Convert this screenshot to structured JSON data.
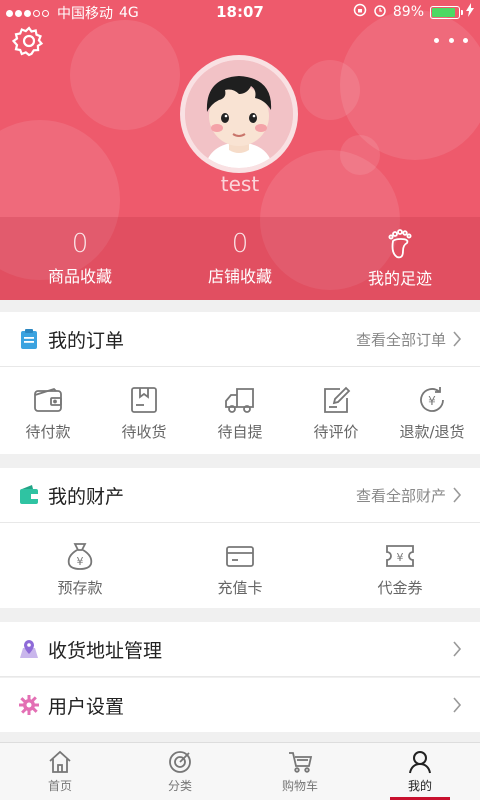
{
  "status_bar": {
    "carrier": "中国移动",
    "network": "4G",
    "time": "18:07",
    "battery": "89%",
    "battery_level": 0.89
  },
  "header": {
    "username": "test",
    "stats": [
      {
        "value": "0",
        "label": "商品收藏"
      },
      {
        "value": "0",
        "label": "店铺收藏"
      },
      {
        "icon": "footprint-icon",
        "label": "我的足迹"
      }
    ]
  },
  "orders": {
    "title": "我的订单",
    "more": "查看全部订单",
    "items": [
      {
        "icon": "wallet-icon",
        "label": "待付款"
      },
      {
        "icon": "box-icon",
        "label": "待收货"
      },
      {
        "icon": "truck-icon",
        "label": "待自提"
      },
      {
        "icon": "edit-icon",
        "label": "待评价"
      },
      {
        "icon": "refund-icon",
        "label": "退款/退货"
      }
    ]
  },
  "assets": {
    "title": "我的财产",
    "more": "查看全部财产",
    "items": [
      {
        "icon": "money-bag-icon",
        "label": "预存款"
      },
      {
        "icon": "card-icon",
        "label": "充值卡"
      },
      {
        "icon": "voucher-icon",
        "label": "代金券"
      }
    ]
  },
  "address": {
    "title": "收货地址管理"
  },
  "settings": {
    "title": "用户设置"
  },
  "tabbar": [
    {
      "icon": "home-icon",
      "label": "首页",
      "active": false
    },
    {
      "icon": "category-icon",
      "label": "分类",
      "active": false
    },
    {
      "icon": "cart-icon",
      "label": "购物车",
      "active": false
    },
    {
      "icon": "user-icon",
      "label": "我的",
      "active": true
    }
  ],
  "colors": {
    "brand": "#ee5a6c",
    "tab_active_indicator": "#c8102e"
  }
}
